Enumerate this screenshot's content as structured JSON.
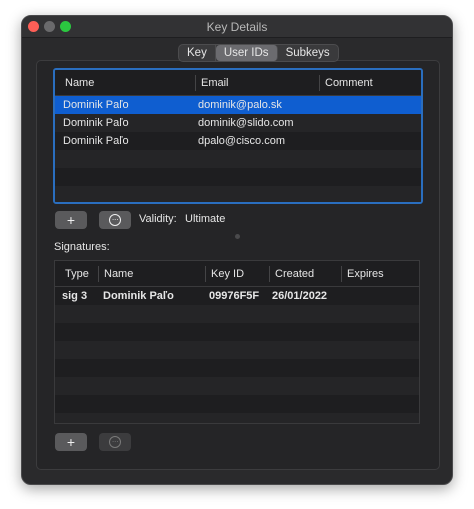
{
  "window": {
    "title": "Key Details"
  },
  "tabs": [
    {
      "label": "Key",
      "active": false
    },
    {
      "label": "User IDs",
      "active": true
    },
    {
      "label": "Subkeys",
      "active": false
    }
  ],
  "user_ids": {
    "columns": [
      "Name",
      "Email",
      "Comment"
    ],
    "rows": [
      {
        "name": "Dominik Paľo",
        "email": "dominik@palo.sk",
        "comment": "",
        "selected": true
      },
      {
        "name": "Dominik Paľo",
        "email": "dominik@slido.com",
        "comment": ""
      },
      {
        "name": "Dominik Paľo",
        "email": "dpalo@cisco.com",
        "comment": ""
      }
    ],
    "add_icon": "plus-icon",
    "more_icon": "ellipsis-circle-icon",
    "validity_label": "Validity:",
    "validity_value": "Ultimate"
  },
  "signatures": {
    "heading": "Signatures:",
    "columns": [
      "Type",
      "Name",
      "Key ID",
      "Created",
      "Expires"
    ],
    "rows": [
      {
        "type": "sig 3",
        "name": "Dominik Paľo",
        "key_id": "09976F5F",
        "created": "26/01/2022",
        "expires": ""
      }
    ],
    "add_icon": "plus-icon",
    "more_icon": "ellipsis-circle-icon"
  },
  "colors": {
    "selection": "#0f5ed0",
    "focus_ring": "#2a6ebf"
  }
}
